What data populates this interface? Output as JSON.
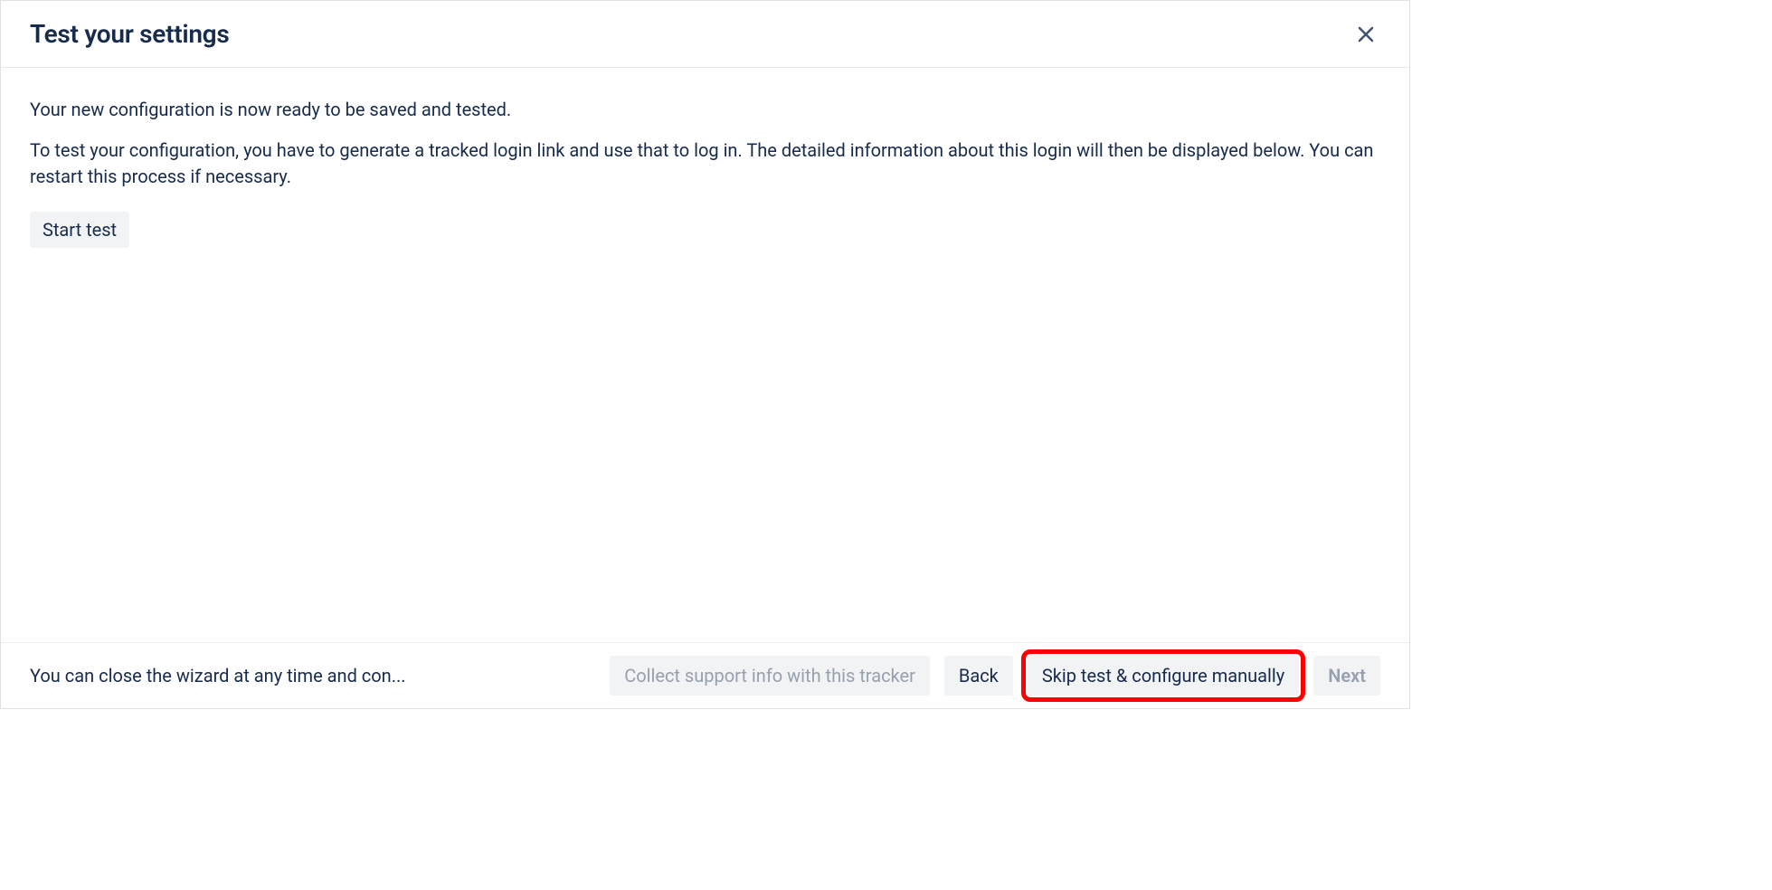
{
  "header": {
    "title": "Test your settings"
  },
  "body": {
    "paragraph1": "Your new configuration is now ready to be saved and tested.",
    "paragraph2": "To test your configuration, you have to generate a tracked login link and use that to log in. The detailed information about this login will then be displayed below. You can restart this process if necessary.",
    "start_test_label": "Start test"
  },
  "footer": {
    "note": "You can close the wizard at any time and con...",
    "collect_support_label": "Collect support info with this tracker",
    "back_label": "Back",
    "skip_test_label": "Skip test & configure manually",
    "next_label": "Next"
  }
}
